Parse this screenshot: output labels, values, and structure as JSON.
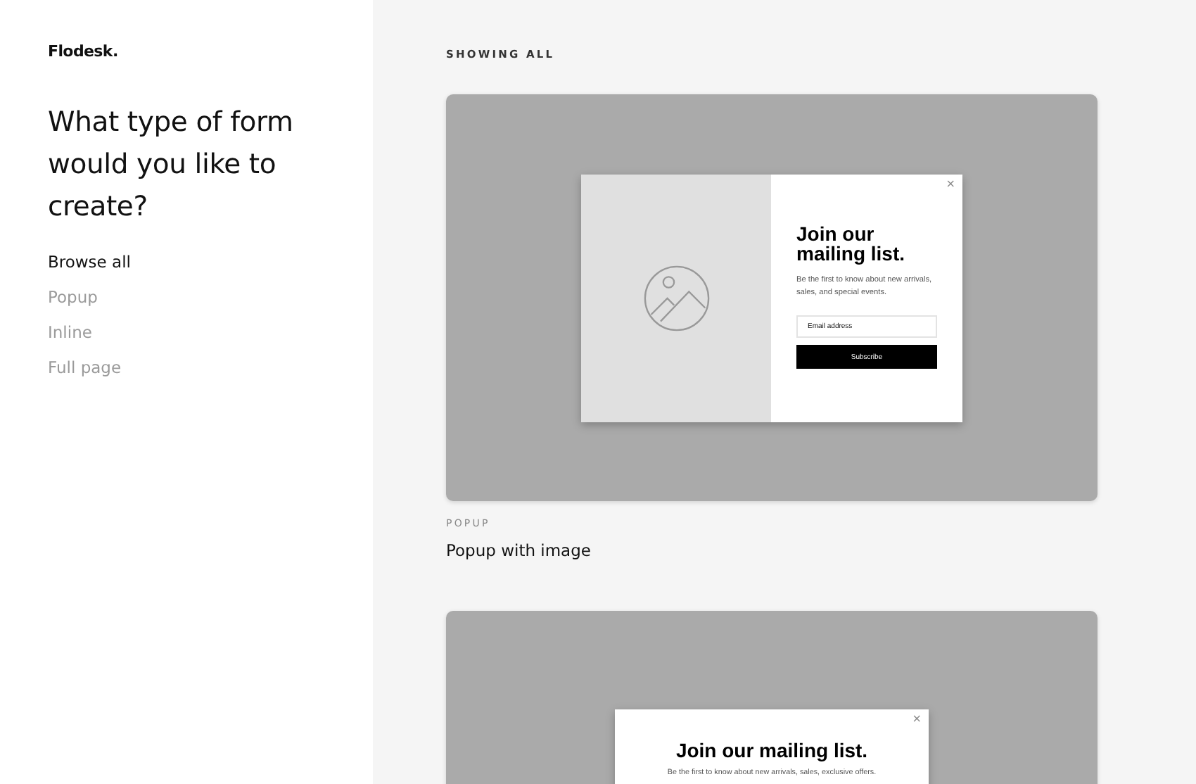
{
  "sidebar": {
    "logo": "Flodesk.",
    "heading": "What type of form would you like to create?",
    "items": [
      {
        "label": "Browse all",
        "selected": true
      },
      {
        "label": "Popup",
        "selected": false
      },
      {
        "label": "Inline",
        "selected": false
      },
      {
        "label": "Full page",
        "selected": false
      }
    ]
  },
  "main": {
    "filter_label": "SHOWING ALL",
    "templates": [
      {
        "kind": "image-split",
        "close": "×",
        "title": "Join our mailing list.",
        "text": "Be the first to know about new arrivals, sales, and special events.",
        "email_placeholder": "Email address",
        "button": "Subscribe",
        "category": "POPUP",
        "name": "Popup with image"
      },
      {
        "kind": "centered",
        "close": "×",
        "title": "Join our mailing list.",
        "text": "Be the first to know about new arrivals, sales, exclusive offers."
      }
    ]
  }
}
